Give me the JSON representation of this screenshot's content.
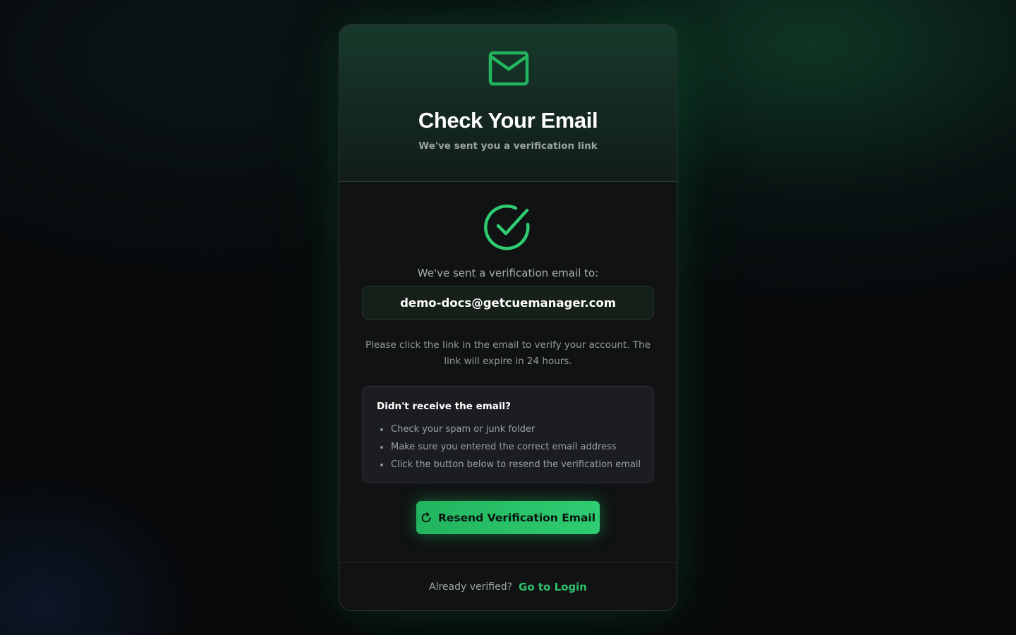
{
  "header": {
    "icon": "mail-icon",
    "title": "Check Your Email",
    "subtitle": "We've sent you a verification link"
  },
  "main": {
    "status_icon": "check-circle-icon",
    "sent_label": "We've sent a verification email to:",
    "email": "demo-docs@getcuemanager.com",
    "instructions": "Please click the link in the email to verify your account. The link will expire in 24 hours."
  },
  "help": {
    "title": "Didn't receive the email?",
    "items": [
      "Check your spam or junk folder",
      "Make sure you entered the correct email address",
      "Click the button below to resend the verification email"
    ]
  },
  "actions": {
    "resend_icon": "refresh-icon",
    "resend_label": "Resend Verification Email"
  },
  "footer": {
    "text": "Already verified?",
    "login_label": "Go to Login"
  },
  "colors": {
    "accent": "#22c55e",
    "accent_link": "#2fc16b",
    "card_background": "#101214",
    "page_background": "#080a0c"
  }
}
